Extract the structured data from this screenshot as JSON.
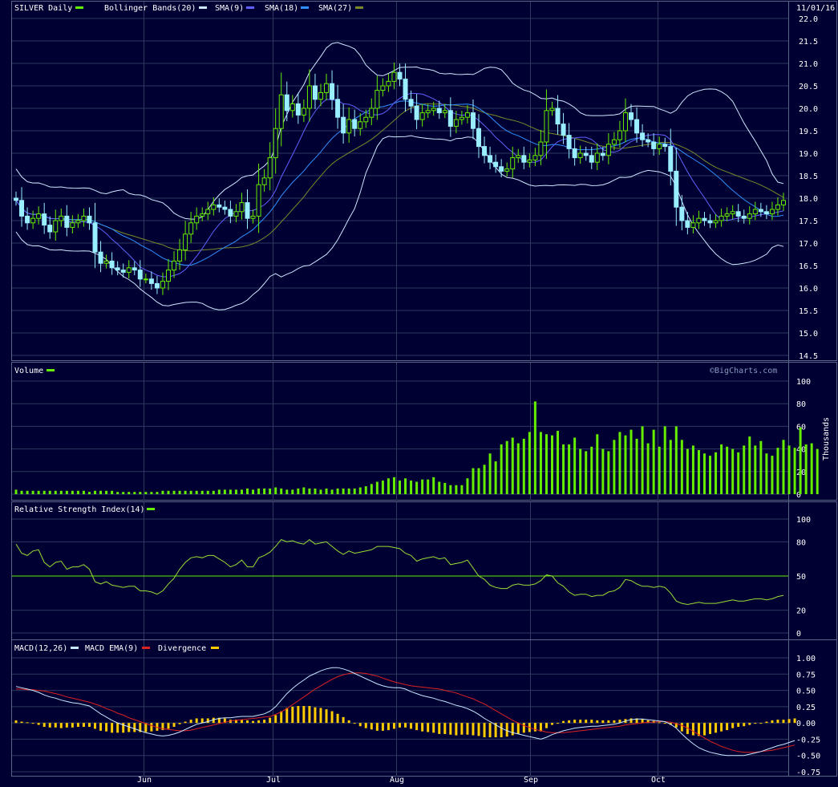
{
  "header": {
    "symbol": "SILVER Daily",
    "date": "11/01/16",
    "legend": [
      {
        "label": "Bollinger Bands(20)",
        "color": "#d0e8ff"
      },
      {
        "label": "SMA(9)",
        "color": "#6060ff"
      },
      {
        "label": "SMA(18)",
        "color": "#2f8fff"
      },
      {
        "label": "SMA(27)",
        "color": "#7a8a2a"
      }
    ],
    "symbol_color": "#66ee00"
  },
  "watermark": "©BigCharts.com",
  "x_labels": [
    "Jun",
    "Jul",
    "Aug",
    "Sep",
    "Oct"
  ],
  "colors": {
    "up": "#66ee00",
    "down": "#99eeff",
    "rsi": "#99dd33",
    "macd": "#c8e8ff",
    "macd_ema": "#dd2222",
    "divergence": "#ffcc00",
    "grid": "#2e3a5e",
    "bg": "#000033"
  },
  "chart_data": [
    {
      "type": "candlestick",
      "title": "SILVER Daily",
      "ylim": [
        14.5,
        22.0
      ],
      "yticks": [
        "22.0",
        "21.5",
        "21.0",
        "20.5",
        "20.0",
        "19.5",
        "19.0",
        "18.5",
        "18.0",
        "17.5",
        "17.0",
        "16.5",
        "16.0",
        "15.5",
        "15.0",
        "14.5"
      ],
      "closes": [
        17.95,
        17.6,
        17.45,
        17.55,
        17.65,
        17.4,
        17.25,
        17.5,
        17.6,
        17.35,
        17.45,
        17.5,
        17.6,
        17.45,
        16.8,
        16.55,
        16.6,
        16.45,
        16.4,
        16.35,
        16.45,
        16.4,
        16.2,
        16.2,
        16.1,
        16.0,
        16.15,
        16.4,
        16.6,
        16.85,
        17.2,
        17.45,
        17.6,
        17.65,
        17.75,
        17.85,
        17.8,
        17.75,
        17.6,
        17.7,
        17.9,
        17.55,
        17.6,
        18.3,
        18.45,
        18.9,
        19.55,
        20.3,
        19.95,
        20.1,
        19.85,
        20.0,
        20.5,
        20.2,
        20.35,
        20.55,
        20.2,
        19.8,
        19.45,
        19.75,
        19.55,
        19.7,
        19.8,
        20.0,
        20.4,
        20.5,
        20.6,
        20.8,
        20.65,
        20.2,
        20.05,
        19.75,
        19.9,
        19.95,
        20.0,
        19.9,
        19.95,
        19.6,
        19.75,
        19.8,
        19.9,
        19.55,
        19.15,
        18.95,
        18.8,
        18.7,
        18.6,
        18.65,
        18.9,
        18.95,
        18.8,
        18.85,
        18.95,
        19.25,
        19.95,
        20.0,
        19.65,
        19.4,
        19.1,
        18.9,
        19.0,
        18.95,
        18.8,
        19.0,
        18.95,
        19.2,
        19.3,
        19.5,
        19.9,
        19.75,
        19.45,
        19.3,
        19.25,
        19.1,
        19.2,
        19.15,
        18.6,
        17.8,
        17.5,
        17.35,
        17.45,
        17.55,
        17.5,
        17.45,
        17.5,
        17.6,
        17.65,
        17.7,
        17.6,
        17.55,
        17.65,
        17.75,
        17.7,
        17.65,
        17.75,
        17.85,
        17.95
      ],
      "vols": [
        4,
        3,
        3,
        3,
        3,
        3,
        3,
        3,
        3,
        3,
        3,
        3,
        3,
        2,
        3,
        3,
        3,
        3,
        2,
        2,
        2,
        2,
        2,
        2,
        2,
        2,
        3,
        3,
        3,
        3,
        3,
        3,
        3,
        3,
        3,
        3,
        4,
        4,
        4,
        4,
        4,
        5,
        4,
        5,
        5,
        5,
        6,
        5,
        4,
        4,
        5,
        6,
        5,
        5,
        4,
        5,
        4,
        5,
        5,
        5,
        5,
        6,
        7,
        9,
        11,
        12,
        14,
        15,
        12,
        14,
        12,
        11,
        13,
        13,
        15,
        11,
        10,
        8,
        8,
        8,
        14,
        23,
        23,
        26,
        36,
        29,
        44,
        47,
        50,
        45,
        49,
        55,
        82,
        55,
        53,
        52,
        56,
        44,
        44,
        50,
        40,
        38,
        42,
        53,
        40,
        38,
        48,
        55,
        52,
        57,
        49,
        60,
        45,
        57,
        42,
        60,
        48,
        60,
        48,
        40,
        43,
        39,
        36,
        34,
        37,
        44,
        42,
        40,
        37,
        43,
        51,
        43,
        47,
        36,
        34,
        41,
        48,
        43,
        41,
        59,
        44,
        45,
        40
      ],
      "vol_ylim": [
        0,
        100
      ],
      "vol_yticks": [
        "100",
        "80",
        "60",
        "40",
        "20",
        "0"
      ],
      "vol_ylabel": "Thousands"
    },
    {
      "type": "line",
      "title": "Relative Strength Index(14)",
      "ylim": [
        0,
        100
      ],
      "yticks": [
        "100",
        "80",
        "50",
        "20",
        "0"
      ],
      "reference_line": 50,
      "rsi": [
        78,
        70,
        68,
        72,
        73,
        62,
        58,
        62,
        63,
        56,
        58,
        58,
        60,
        56,
        45,
        43,
        45,
        42,
        41,
        40,
        41,
        41,
        37,
        37,
        36,
        34,
        37,
        43,
        48,
        56,
        62,
        66,
        67,
        66,
        68,
        68,
        65,
        62,
        58,
        60,
        64,
        58,
        58,
        66,
        68,
        71,
        76,
        82,
        80,
        81,
        79,
        78,
        82,
        78,
        79,
        80,
        76,
        72,
        69,
        72,
        70,
        71,
        72,
        73,
        76,
        76,
        76,
        75,
        74,
        70,
        68,
        63,
        65,
        66,
        67,
        65,
        66,
        60,
        61,
        62,
        64,
        57,
        50,
        47,
        42,
        40,
        39,
        39,
        42,
        43,
        42,
        42,
        43,
        46,
        51,
        50,
        44,
        41,
        36,
        33,
        34,
        34,
        32,
        33,
        33,
        36,
        37,
        40,
        47,
        46,
        43,
        41,
        41,
        40,
        41,
        40,
        35,
        28,
        26,
        25,
        26,
        27,
        26,
        26,
        26,
        27,
        28,
        29,
        28,
        28,
        29,
        30,
        30,
        29,
        30,
        32,
        33
      ],
      "mid_color": "#66ee00"
    },
    {
      "type": "line",
      "title": "MACD(12,26)",
      "series": [
        {
          "name": "MACD EMA(9)",
          "color": "#dd2222"
        },
        {
          "name": "Divergence",
          "color": "#ffcc00"
        }
      ],
      "ylim": [
        -0.75,
        1.0
      ],
      "yticks": [
        "1.00",
        "0.75",
        "0.50",
        "0.25",
        "0.00",
        "-0.25",
        "-0.50",
        "-0.75"
      ],
      "macd": [
        0.56,
        0.54,
        0.52,
        0.5,
        0.47,
        0.43,
        0.4,
        0.38,
        0.35,
        0.33,
        0.31,
        0.3,
        0.28,
        0.26,
        0.2,
        0.14,
        0.09,
        0.04,
        0.0,
        -0.03,
        -0.06,
        -0.09,
        -0.12,
        -0.15,
        -0.17,
        -0.19,
        -0.2,
        -0.19,
        -0.17,
        -0.14,
        -0.1,
        -0.06,
        -0.02,
        0.0,
        0.02,
        0.05,
        0.07,
        0.08,
        0.08,
        0.09,
        0.1,
        0.1,
        0.1,
        0.12,
        0.14,
        0.18,
        0.25,
        0.35,
        0.45,
        0.53,
        0.6,
        0.66,
        0.72,
        0.76,
        0.8,
        0.83,
        0.85,
        0.85,
        0.83,
        0.8,
        0.76,
        0.72,
        0.68,
        0.64,
        0.6,
        0.57,
        0.55,
        0.54,
        0.54,
        0.52,
        0.48,
        0.45,
        0.42,
        0.4,
        0.38,
        0.35,
        0.33,
        0.3,
        0.27,
        0.25,
        0.22,
        0.18,
        0.13,
        0.07,
        0.02,
        -0.03,
        -0.08,
        -0.12,
        -0.15,
        -0.17,
        -0.19,
        -0.21,
        -0.23,
        -0.25,
        -0.22,
        -0.18,
        -0.15,
        -0.12,
        -0.1,
        -0.08,
        -0.07,
        -0.06,
        -0.05,
        -0.05,
        -0.04,
        -0.03,
        -0.02,
        0.0,
        0.03,
        0.05,
        0.06,
        0.06,
        0.05,
        0.04,
        0.03,
        0.02,
        -0.02,
        -0.08,
        -0.17,
        -0.25,
        -0.32,
        -0.38,
        -0.42,
        -0.45,
        -0.47,
        -0.49,
        -0.5,
        -0.5,
        -0.5,
        -0.5,
        -0.48,
        -0.46,
        -0.44,
        -0.41,
        -0.38,
        -0.35,
        -0.33,
        -0.3,
        -0.27
      ],
      "signal": [
        0.52,
        0.52,
        0.51,
        0.51,
        0.5,
        0.49,
        0.47,
        0.45,
        0.43,
        0.4,
        0.38,
        0.36,
        0.34,
        0.32,
        0.29,
        0.26,
        0.22,
        0.19,
        0.15,
        0.12,
        0.08,
        0.05,
        0.02,
        -0.01,
        -0.04,
        -0.07,
        -0.09,
        -0.1,
        -0.11,
        -0.12,
        -0.12,
        -0.11,
        -0.09,
        -0.07,
        -0.05,
        -0.03,
        -0.01,
        0.01,
        0.03,
        0.04,
        0.05,
        0.06,
        0.07,
        0.08,
        0.09,
        0.1,
        0.13,
        0.17,
        0.22,
        0.28,
        0.34,
        0.4,
        0.46,
        0.52,
        0.57,
        0.62,
        0.67,
        0.71,
        0.74,
        0.76,
        0.77,
        0.77,
        0.76,
        0.74,
        0.72,
        0.69,
        0.66,
        0.63,
        0.61,
        0.59,
        0.57,
        0.56,
        0.55,
        0.54,
        0.53,
        0.52,
        0.5,
        0.48,
        0.46,
        0.43,
        0.4,
        0.37,
        0.33,
        0.29,
        0.24,
        0.19,
        0.14,
        0.09,
        0.04,
        0.0,
        -0.04,
        -0.07,
        -0.1,
        -0.12,
        -0.14,
        -0.15,
        -0.15,
        -0.15,
        -0.14,
        -0.13,
        -0.12,
        -0.11,
        -0.1,
        -0.09,
        -0.08,
        -0.07,
        -0.06,
        -0.05,
        -0.03,
        -0.02,
        -0.01,
        0.0,
        0.01,
        0.01,
        0.02,
        0.02,
        0.01,
        -0.01,
        -0.04,
        -0.08,
        -0.13,
        -0.18,
        -0.23,
        -0.28,
        -0.32,
        -0.36,
        -0.39,
        -0.42,
        -0.44,
        -0.45,
        -0.45,
        -0.45,
        -0.44,
        -0.43,
        -0.42,
        -0.4,
        -0.38,
        -0.36,
        -0.34
      ]
    }
  ]
}
